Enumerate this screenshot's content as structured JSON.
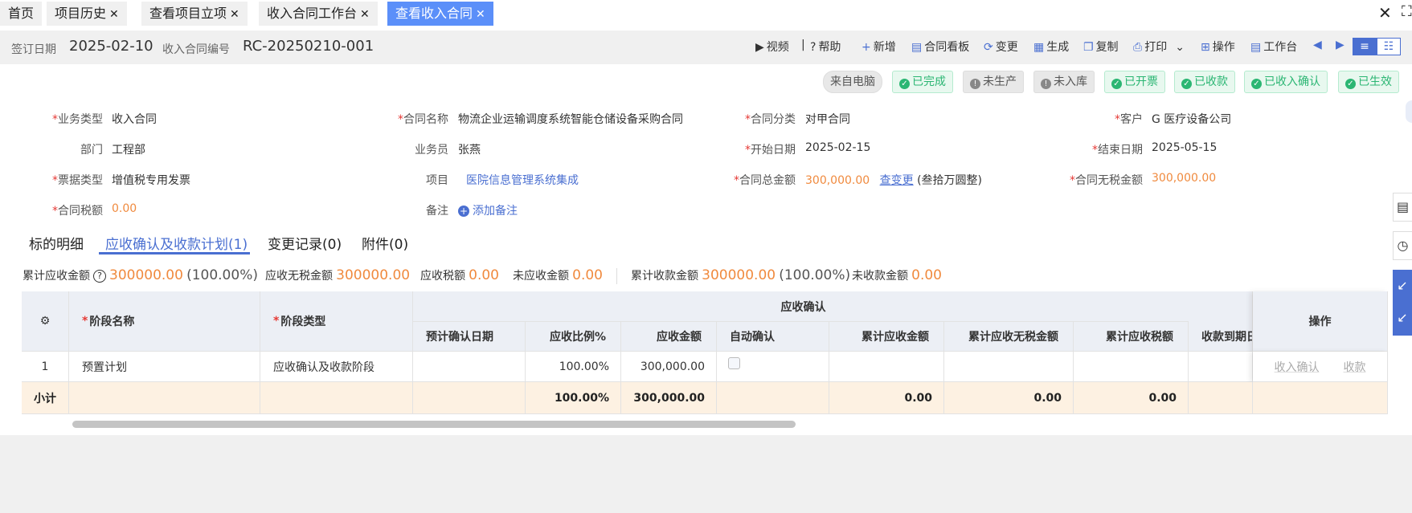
{
  "tabs": [
    {
      "label": "首页",
      "closable": false,
      "active": false
    },
    {
      "label": "项目历史",
      "closable": true,
      "active": false
    },
    {
      "label": "查看项目立项",
      "closable": true,
      "active": false
    },
    {
      "label": "收入合同工作台",
      "closable": true,
      "active": false
    },
    {
      "label": "查看收入合同",
      "closable": true,
      "active": true
    }
  ],
  "header": {
    "sign_date_label": "签订日期",
    "sign_date": "2025-02-10",
    "contract_no_label": "收入合同编号",
    "contract_no": "RC-20250210-001"
  },
  "toolbar": {
    "video": "视频",
    "help": "帮助",
    "add": "新增",
    "board": "合同看板",
    "change": "变更",
    "generate": "生成",
    "copy": "复制",
    "print": "打印",
    "operate": "操作",
    "workbench": "工作台"
  },
  "statuses": [
    {
      "label": "来自电脑",
      "kind": "source"
    },
    {
      "label": "已完成",
      "kind": "done"
    },
    {
      "label": "未生产",
      "kind": "pending"
    },
    {
      "label": "未入库",
      "kind": "pending"
    },
    {
      "label": "已开票",
      "kind": "done"
    },
    {
      "label": "已收款",
      "kind": "done"
    },
    {
      "label": "已收入确认",
      "kind": "done"
    },
    {
      "label": "已生效",
      "kind": "done"
    }
  ],
  "form": {
    "business_type": {
      "label": "业务类型",
      "value": "收入合同",
      "required": true
    },
    "contract_name": {
      "label": "合同名称",
      "value": "物流企业运输调度系统智能仓储设备采购合同",
      "required": true
    },
    "contract_category": {
      "label": "合同分类",
      "value": "对甲合同",
      "required": true
    },
    "customer": {
      "label": "客户",
      "value": "G 医疗设备公司",
      "required": true
    },
    "department": {
      "label": "部门",
      "value": "工程部",
      "required": false
    },
    "salesperson": {
      "label": "业务员",
      "value": "张燕",
      "required": false
    },
    "start_date": {
      "label": "开始日期",
      "value": "2025-02-15",
      "required": true
    },
    "end_date": {
      "label": "结束日期",
      "value": "2025-05-15",
      "required": true
    },
    "invoice_type": {
      "label": "票据类型",
      "value": "增值税专用发票",
      "required": true
    },
    "project": {
      "label": "项目",
      "value": "医院信息管理系统集成",
      "required": false
    },
    "total_amount": {
      "label": "合同总金额",
      "value": "300,000.00",
      "link": "查变更",
      "chinese": "(叁拾万圆整)",
      "required": true
    },
    "amount_excl_tax": {
      "label": "合同无税金额",
      "value": "300,000.00",
      "required": true
    },
    "tax_amount": {
      "label": "合同税额",
      "value": "0.00",
      "required": true
    },
    "remark": {
      "label": "备注",
      "action": "添加备注",
      "required": false
    }
  },
  "subtabs": [
    {
      "label": "标的明细",
      "active": false
    },
    {
      "label": "应收确认及收款计划(1)",
      "active": true
    },
    {
      "label": "变更记录(0)",
      "active": false
    },
    {
      "label": "附件(0)",
      "active": false
    }
  ],
  "summary": {
    "cum_receivable_label": "累计应收金额",
    "cum_receivable": "300000.00",
    "cum_receivable_pct": "(100.00%)",
    "receivable_excl_tax_label": "应收无税金额",
    "receivable_excl_tax": "300000.00",
    "receivable_tax_label": "应收税额",
    "receivable_tax": "0.00",
    "not_receivable_label": "未应收金额",
    "not_receivable": "0.00",
    "cum_collected_label": "累计收款金额",
    "cum_collected": "300000.00",
    "cum_collected_pct": "(100.00%)",
    "uncollected_label": "未收款金额",
    "uncollected": "0.00"
  },
  "table": {
    "group_header": "应收确认",
    "headers": {
      "stage_name": "阶段名称",
      "stage_type": "阶段类型",
      "expected_date": "预计确认日期",
      "ratio": "应收比例%",
      "amount": "应收金额",
      "auto_confirm": "自动确认",
      "cum_amount": "累计应收金额",
      "cum_excl_tax": "累计应收无税金额",
      "cum_tax": "累计应收税额",
      "due": "收款到期日",
      "ops": "操作"
    },
    "rows": [
      {
        "index": "1",
        "stage_name": "预置计划",
        "stage_type": "应收确认及收款阶段",
        "expected_date": "",
        "ratio": "100.00%",
        "amount": "300,000.00",
        "auto_confirm": false,
        "cum_amount": "",
        "cum_excl_tax": "",
        "cum_tax": "",
        "due": "",
        "op_confirm": "收入确认",
        "op_collect": "收款"
      }
    ],
    "subtotal": {
      "label": "小计",
      "ratio": "100.00%",
      "amount": "300,000.00",
      "cum_amount": "0.00",
      "cum_excl_tax": "0.00",
      "cum_tax": "0.00"
    }
  },
  "colors": {
    "accent": "#4a6fd1",
    "tab_active": "#5b8ff9",
    "orange": "#f08a3e",
    "green": "#2bb673",
    "required": "#e53935"
  }
}
